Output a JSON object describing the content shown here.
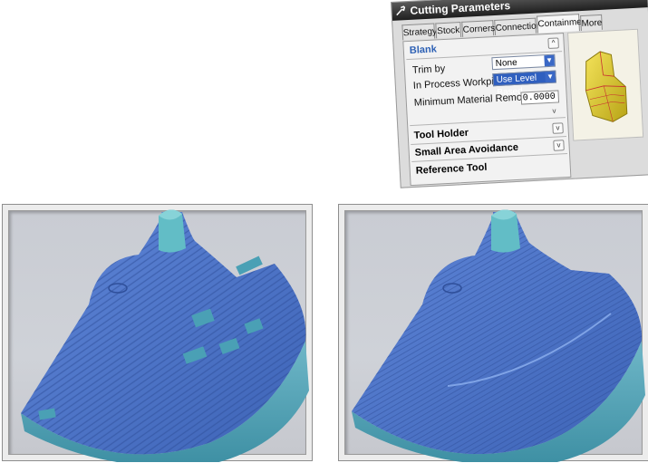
{
  "dialog": {
    "title": "Cutting Parameters",
    "tabs": [
      "Strategy",
      "Stock",
      "Corners",
      "Connections",
      "Containment",
      "More"
    ],
    "active_tab": "Containment",
    "sections": {
      "blank": "Blank",
      "tool_holder": "Tool Holder",
      "small_area_avoidance": "Small Area Avoidance",
      "reference_tool": "Reference Tool"
    },
    "fields": {
      "trim_by_label": "Trim by",
      "trim_by_value": "None",
      "in_process_workpiece_label": "In Process Workpiece",
      "in_process_workpiece_value": "Use Level Based",
      "min_material_removed_label": "Minimum Material Removed",
      "min_material_removed_value": "0.0000"
    }
  },
  "colors": {
    "part_blue": "#4a74c9",
    "part_side_teal": "#5aa6b8",
    "viewport_bg": "#c9ccd3"
  }
}
